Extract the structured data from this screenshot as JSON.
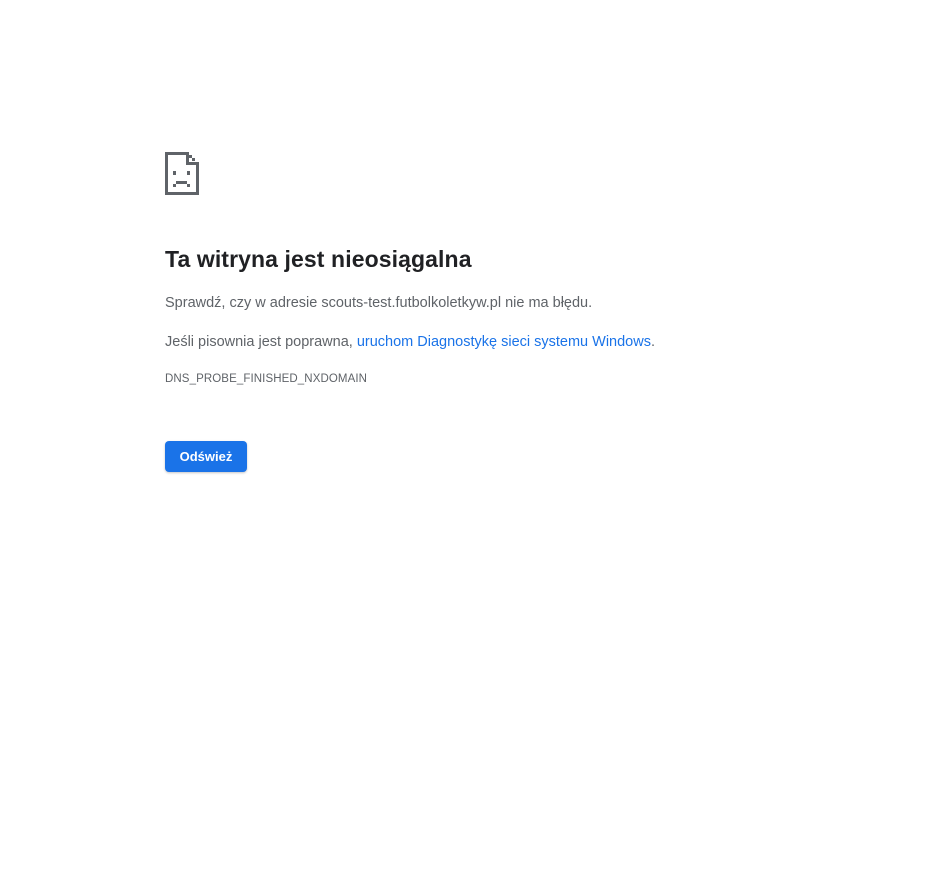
{
  "error_page": {
    "icon": "sad-page-icon",
    "title": "Ta witryna jest nieosiągalna",
    "check_text": "Sprawdź, czy w adresie scouts-test.futbolkoletkyw.pl nie ma błędu.",
    "spelling_prefix": "Jeśli pisownia jest poprawna, ",
    "diagnostics_link": "uruchom Diagnostykę sieci systemu Windows",
    "spelling_suffix": ".",
    "error_code": "DNS_PROBE_FINISHED_NXDOMAIN",
    "reload_label": "Odśwież"
  },
  "colors": {
    "accent": "#1a73e8",
    "title": "#202124",
    "body_text": "#5f6368",
    "background": "#ffffff"
  }
}
